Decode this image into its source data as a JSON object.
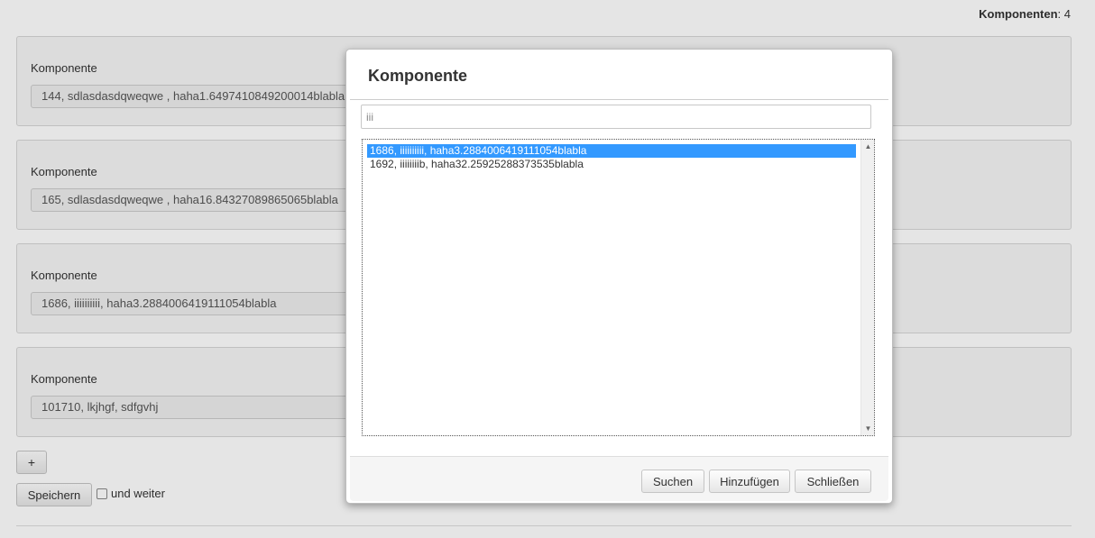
{
  "header": {
    "count_label": "Komponenten",
    "count_value": "4"
  },
  "components": [
    {
      "label": "Komponente",
      "value": "144, sdlasdasdqweqwe , haha1.6497410849200014blabla"
    },
    {
      "label": "Komponente",
      "value": "165, sdlasdasdqweqwe , haha16.84327089865065blabla"
    },
    {
      "label": "Komponente",
      "value": "1686, iiiiiiiiii, haha3.2884006419111054blabla"
    },
    {
      "label": "Komponente",
      "value": "101710, lkjhgf, sdfgvhj"
    }
  ],
  "actions": {
    "add_label": "+",
    "save_label": "Speichern",
    "continue_label": "und weiter"
  },
  "modal": {
    "title": "Komponente",
    "search_value": "iii",
    "options": [
      {
        "text": "1686, iiiiiiiiii, haha3.2884006419111054blabla",
        "selected": true
      },
      {
        "text": "1692, iiiiiiiib, haha32.25925288373535blabla",
        "selected": false
      }
    ],
    "buttons": {
      "search": "Suchen",
      "add": "Hinzufügen",
      "close": "Schließen"
    }
  },
  "colors": {
    "selection": "#3399ff",
    "page_bg": "#e5e5e5"
  }
}
